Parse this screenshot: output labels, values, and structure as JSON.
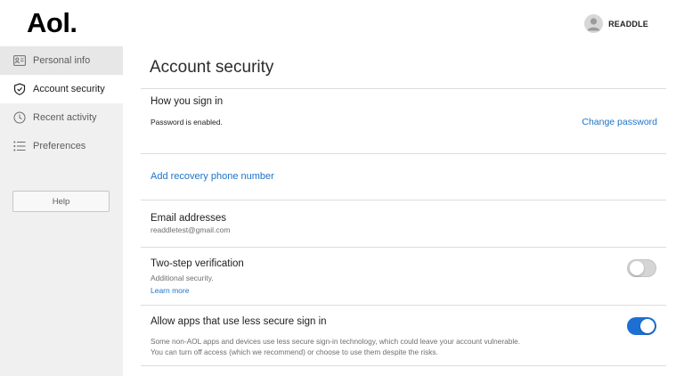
{
  "header": {
    "logo_text": "Aol.",
    "username": "READDLE"
  },
  "sidebar": {
    "items": [
      {
        "label": "Personal info",
        "icon": "id-card-icon"
      },
      {
        "label": "Account security",
        "icon": "shield-icon"
      },
      {
        "label": "Recent activity",
        "icon": "clock-icon"
      },
      {
        "label": "Preferences",
        "icon": "list-icon"
      }
    ],
    "help_label": "Help"
  },
  "main": {
    "title": "Account security",
    "sign_in": {
      "title": "How you sign in",
      "status": "Password is enabled.",
      "change_link": "Change password"
    },
    "recovery": {
      "link": "Add recovery phone number"
    },
    "email": {
      "title": "Email addresses",
      "address": "readdletest@gmail.com"
    },
    "two_step": {
      "title": "Two-step verification",
      "subtitle": "Additional security.",
      "learn_more": "Learn more",
      "enabled": false
    },
    "less_secure": {
      "title": "Allow apps that use less secure sign in",
      "desc_line1": "Some non-AOL apps and devices use less secure sign-in technology, which could leave your account vulnerable.",
      "desc_line2": "You can turn off access (which we recommend) or choose to use them despite the risks.",
      "enabled": true
    }
  },
  "colors": {
    "accent": "#1e73c8",
    "toggle_on": "#1d6fd3",
    "sidebar_bg": "#f0f0f1"
  }
}
